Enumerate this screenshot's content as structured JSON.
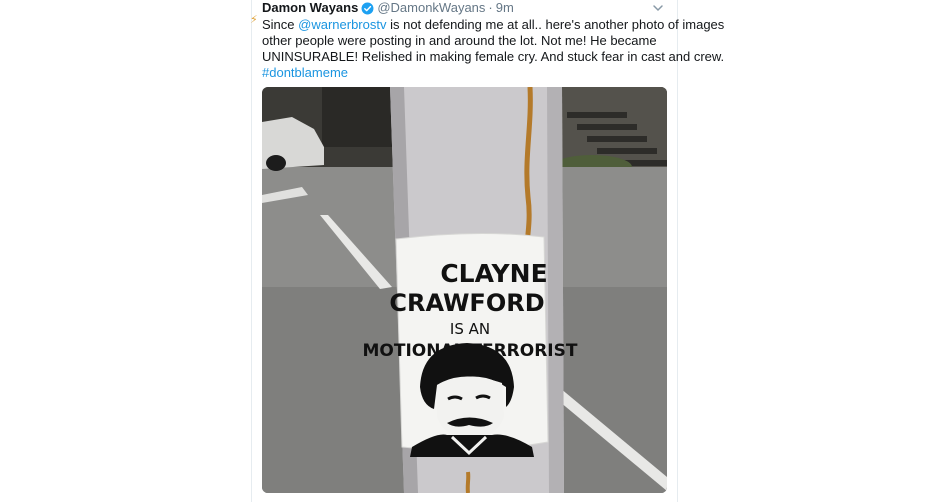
{
  "tweet": {
    "display_name": "Damon Wayans",
    "handle": "@DamonkWayans",
    "separator": "·",
    "time": "9m",
    "text": {
      "line1_prefix": "Since ",
      "mention": "@warnerbrostv",
      "line1_suffix": " is not defending me at all.. here's another photo of images",
      "line2": "other people were posting in and around the lot.  Not me!  He became",
      "line3": "UNINSURABLE!  Relished in making female cry. And stuck fear in cast and crew.",
      "hashtag": "#dontblameme"
    }
  },
  "photo": {
    "sticker": {
      "line1": "CLAYNE",
      "line2": "CRAWFORD",
      "line3": "IS AN",
      "line4": "MOTIONAL TERRORIST"
    }
  },
  "icons": {
    "verified": "verified-badge-icon",
    "caret": "chevron-down-icon"
  },
  "colors": {
    "link": "#1b95e0",
    "verified": "#1da1f2",
    "text": "#14171a",
    "secondary": "#657786"
  }
}
